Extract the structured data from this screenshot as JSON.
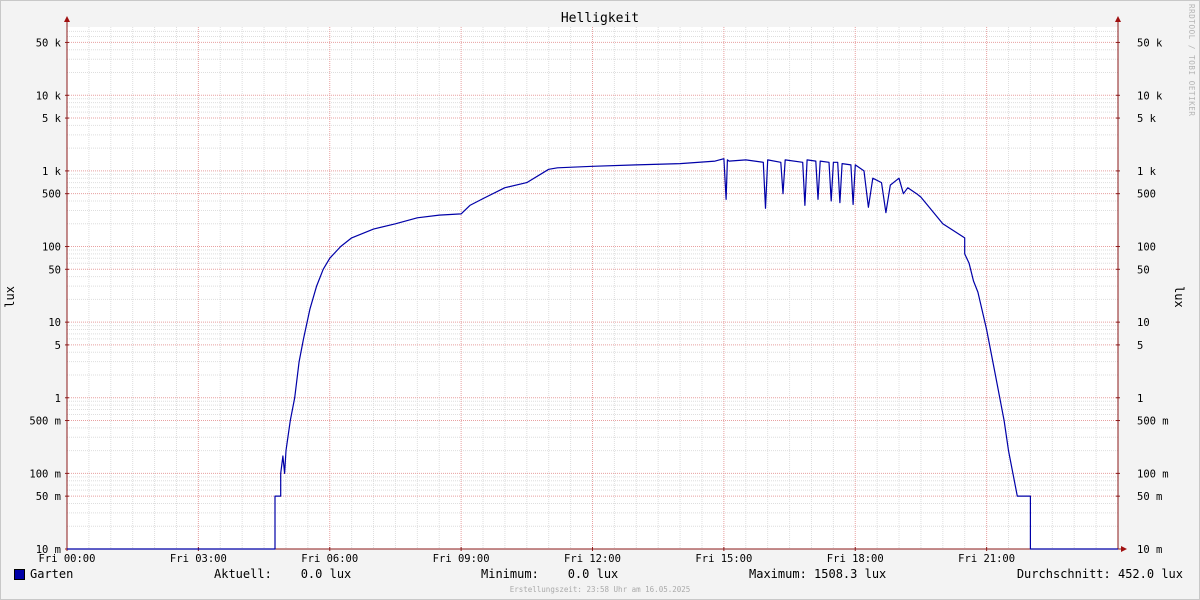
{
  "chart_data": {
    "type": "line",
    "title": "Helligkeit",
    "ylabel": "lux",
    "xlabel": "",
    "watermark": "RRDTOOL / TOBI OETIKER",
    "yscale": "log",
    "ylim": [
      0.01,
      80000
    ],
    "xlim": [
      0,
      24
    ],
    "x_ticks": [
      {
        "x": 0,
        "label": "Fri 00:00"
      },
      {
        "x": 3,
        "label": "Fri 03:00"
      },
      {
        "x": 6,
        "label": "Fri 06:00"
      },
      {
        "x": 9,
        "label": "Fri 09:00"
      },
      {
        "x": 12,
        "label": "Fri 12:00"
      },
      {
        "x": 15,
        "label": "Fri 15:00"
      },
      {
        "x": 18,
        "label": "Fri 18:00"
      },
      {
        "x": 21,
        "label": "Fri 21:00"
      }
    ],
    "y_ticks": [
      {
        "y": 0.01,
        "label": "10 m"
      },
      {
        "y": 0.05,
        "label": "50 m"
      },
      {
        "y": 0.1,
        "label": "100 m"
      },
      {
        "y": 0.5,
        "label": "500 m"
      },
      {
        "y": 1,
        "label": "1"
      },
      {
        "y": 5,
        "label": "5"
      },
      {
        "y": 10,
        "label": "10"
      },
      {
        "y": 50,
        "label": "50"
      },
      {
        "y": 100,
        "label": "100"
      },
      {
        "y": 500,
        "label": "500"
      },
      {
        "y": 1000,
        "label": "1 k"
      },
      {
        "y": 5000,
        "label": "5 k"
      },
      {
        "y": 10000,
        "label": "10 k"
      },
      {
        "y": 50000,
        "label": "50 k"
      }
    ],
    "grid": true,
    "series": [
      {
        "name": "Garten",
        "color": "#0000a8",
        "x": [
          0,
          4.75,
          4.75,
          4.88,
          4.88,
          4.93,
          4.97,
          5.0,
          5.1,
          5.2,
          5.3,
          5.4,
          5.55,
          5.7,
          5.85,
          6.0,
          6.25,
          6.5,
          7.0,
          7.5,
          8.0,
          8.5,
          9.0,
          9.2,
          9.5,
          10.0,
          10.5,
          11.0,
          11.2,
          12.0,
          13.0,
          14.0,
          14.8,
          15.0,
          15.05,
          15.08,
          15.12,
          15.5,
          15.9,
          15.95,
          16.0,
          16.3,
          16.35,
          16.4,
          16.8,
          16.85,
          16.9,
          17.1,
          17.15,
          17.2,
          17.4,
          17.45,
          17.5,
          17.6,
          17.65,
          17.7,
          17.9,
          17.95,
          18.0,
          18.2,
          18.3,
          18.4,
          18.6,
          18.7,
          18.8,
          19.0,
          19.1,
          19.2,
          19.4,
          19.5,
          20.0,
          20.5,
          20.5,
          20.6,
          20.7,
          20.8,
          21.0,
          21.2,
          21.4,
          21.5,
          21.6,
          21.7,
          21.8,
          22.0,
          22.0,
          24.0
        ],
        "y": [
          0.01,
          0.01,
          0.05,
          0.05,
          0.1,
          0.17,
          0.1,
          0.2,
          0.5,
          1.0,
          3.0,
          6.0,
          15,
          30,
          50,
          70,
          100,
          130,
          170,
          200,
          240,
          260,
          270,
          350,
          430,
          600,
          700,
          1050,
          1100,
          1150,
          1200,
          1250,
          1350,
          1450,
          420,
          1400,
          1350,
          1400,
          1300,
          320,
          1400,
          1300,
          500,
          1400,
          1300,
          350,
          1400,
          1350,
          420,
          1350,
          1300,
          400,
          1300,
          1300,
          380,
          1250,
          1200,
          360,
          1200,
          1000,
          330,
          800,
          700,
          280,
          650,
          800,
          500,
          600,
          500,
          450,
          200,
          130,
          80,
          60,
          35,
          25,
          8,
          2,
          0.5,
          0.2,
          0.1,
          0.05,
          0.05,
          0.05,
          0.01,
          0.01
        ]
      }
    ]
  },
  "legend": {
    "name": "Garten",
    "current": "Aktuell:    0.0 lux",
    "minimum": "Minimum:    0.0 lux",
    "maximum": "Maximum: 1508.3 lux",
    "average": "Durchschnitt: 452.0 lux"
  },
  "footer": "Erstellungszeit: 23:58 Uhr am 16.05.2025"
}
